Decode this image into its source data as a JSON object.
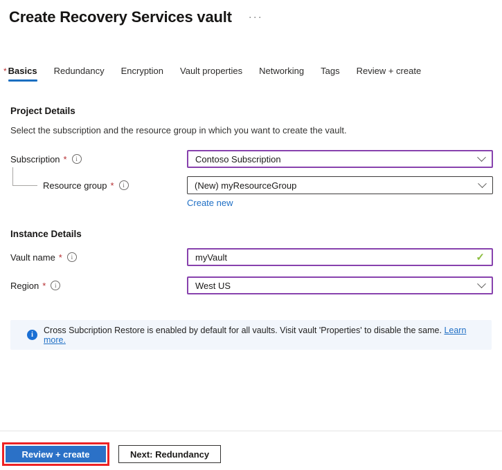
{
  "header": {
    "title": "Create Recovery Services vault"
  },
  "icons": {
    "more_options": "···",
    "info": "i",
    "checkmark": "✓"
  },
  "tabs": [
    {
      "label": "Basics",
      "required_marker": "*",
      "selected": true
    },
    {
      "label": "Redundancy"
    },
    {
      "label": "Encryption"
    },
    {
      "label": "Vault properties"
    },
    {
      "label": "Networking"
    },
    {
      "label": "Tags"
    },
    {
      "label": "Review + create"
    }
  ],
  "project_details": {
    "heading": "Project Details",
    "description": "Select the subscription and the resource group in which you want to create the vault.",
    "fields": {
      "subscription": {
        "label": "Subscription",
        "required_marker": "*",
        "value": "Contoso Subscription"
      },
      "resource_group": {
        "label": "Resource group",
        "required_marker": "*",
        "value": "(New) myResourceGroup",
        "create_new_link": "Create new"
      }
    }
  },
  "instance_details": {
    "heading": "Instance Details",
    "fields": {
      "vault_name": {
        "label": "Vault name",
        "required_marker": "*",
        "value": "myVault"
      },
      "region": {
        "label": "Region",
        "required_marker": "*",
        "value": "West US"
      }
    }
  },
  "info_banner": {
    "message": "Cross Subcription Restore is enabled by default for all vaults. Visit vault 'Properties' to disable the same. ",
    "link_label": "Learn more."
  },
  "footer": {
    "review_create_button": "Review + create",
    "next_button": "Next: Redundancy"
  },
  "colors": {
    "accent_blue": "#1a6ec0",
    "link_blue": "#1f6fc5",
    "primary_button_blue": "#2b71c7",
    "edited_field_border_purple": "#8741ad",
    "default_field_border": "#3b3a39",
    "required_asterisk_red": "#b52e31",
    "valid_checkmark_green": "#8cbe3f",
    "highlight_annotation_red": "#ed2224",
    "info_icon_blue": "#1a6fd4",
    "banner_background": "#f2f6fc"
  }
}
